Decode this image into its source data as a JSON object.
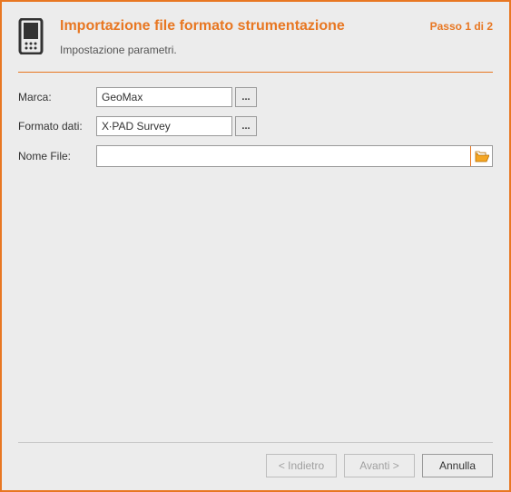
{
  "header": {
    "title": "Importazione file formato strumentazione",
    "step": "Passo 1 di 2",
    "subtitle": "Impostazione parametri."
  },
  "form": {
    "brand_label": "Marca:",
    "brand_value": "GeoMax",
    "format_label": "Formato dati:",
    "format_value": "X∙PAD Survey",
    "filename_label": "Nome File:",
    "filename_value": "",
    "browse_dots": "..."
  },
  "footer": {
    "back": "< Indietro",
    "next": "Avanti >",
    "cancel": "Annulla"
  }
}
